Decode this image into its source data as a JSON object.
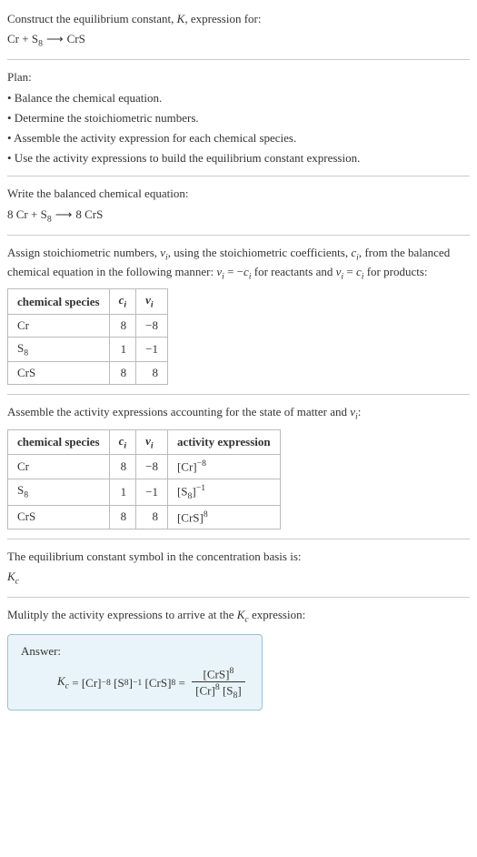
{
  "title": "Construct the equilibrium constant, K, expression for:",
  "unbalanced_equation": "Cr + S₈  ⟶  CrS",
  "plan_heading": "Plan:",
  "plan_items": [
    "• Balance the chemical equation.",
    "• Determine the stoichiometric numbers.",
    "• Assemble the activity expression for each chemical species.",
    "• Use the activity expressions to build the equilibrium constant expression."
  ],
  "balanced_heading": "Write the balanced chemical equation:",
  "balanced_equation": "8 Cr + S₈  ⟶  8 CrS",
  "stoich_heading": "Assign stoichiometric numbers, νᵢ, using the stoichiometric coefficients, cᵢ, from the balanced chemical equation in the following manner: νᵢ = −cᵢ for reactants and νᵢ = cᵢ for products:",
  "table1": {
    "headers": [
      "chemical species",
      "cᵢ",
      "νᵢ"
    ],
    "rows": [
      [
        "Cr",
        "8",
        "−8"
      ],
      [
        "S₈",
        "1",
        "−1"
      ],
      [
        "CrS",
        "8",
        "8"
      ]
    ]
  },
  "activity_heading": "Assemble the activity expressions accounting for the state of matter and νᵢ:",
  "table2": {
    "headers": [
      "chemical species",
      "cᵢ",
      "νᵢ",
      "activity expression"
    ],
    "rows": [
      [
        "Cr",
        "8",
        "−8",
        "[Cr]⁻⁸"
      ],
      [
        "S₈",
        "1",
        "−1",
        "[S₈]⁻¹"
      ],
      [
        "CrS",
        "8",
        "8",
        "[CrS]⁸"
      ]
    ]
  },
  "symbol_heading": "The equilibrium constant symbol in the concentration basis is:",
  "symbol": "K𝒸",
  "multiply_heading": "Mulitply the activity expressions to arrive at the K𝒸 expression:",
  "answer_label": "Answer:",
  "answer_plain": "K𝒸 = [Cr]⁻⁸ [S₈]⁻¹ [CrS]⁸ =",
  "answer_frac_num": "[CrS]⁸",
  "answer_frac_den": "[Cr]⁸ [S₈]"
}
